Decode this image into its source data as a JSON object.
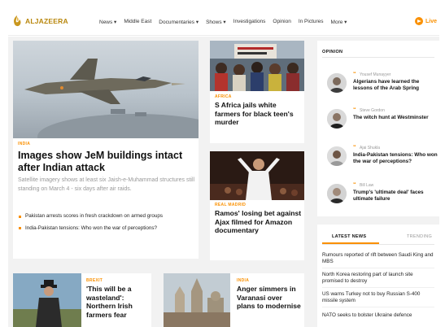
{
  "brand": {
    "name": "ALJAZEERA",
    "accent": "#fa9000",
    "logo_color": "#b8860b"
  },
  "nav": {
    "items": [
      "News ▾",
      "Middle East",
      "Documentaries ▾",
      "Shows ▾",
      "Investigations",
      "Opinion",
      "In Pictures",
      "More ▾"
    ],
    "live_label": "Live"
  },
  "hero": {
    "tag": "INDIA",
    "title": "Images show JeM buildings intact after Indian attack",
    "summary": "Satellite imagery shows at least six Jaish-e-Muhammad structures still standing on March 4 - six days after air raids.",
    "bullets": [
      "Pakistan arrests scores in fresh crackdown on armed groups",
      "India-Pakistan tensions: Who won the war of perceptions?"
    ]
  },
  "cards": {
    "mid1": {
      "tag": "AFRICA",
      "title": "S Africa jails white farmers for black teen's murder"
    },
    "mid2": {
      "tag": "REAL MADRID",
      "title": "Ramos' losing bet against Ajax filmed for Amazon documentary"
    },
    "bot1": {
      "tag": "BREXIT",
      "title": "'This will be a wasteland': Northern Irish farmers fear"
    },
    "bot2": {
      "tag": "INDIA",
      "title": "Anger simmers in Varanasi over plans to modernise"
    }
  },
  "opinion": {
    "label": "OPINION",
    "items": [
      {
        "author": "Yousef Munayyer",
        "title": "Algerians have learned the lessons of the Arab Spring"
      },
      {
        "author": "Steve Gordon",
        "title": "The witch hunt at Westminster"
      },
      {
        "author": "Ajai Shukla",
        "title": "India-Pakistan tensions: Who won the war of perceptions?"
      },
      {
        "author": "Bill Law",
        "title": "Trump's 'ultimate deal' faces ultimate failure"
      }
    ]
  },
  "latest": {
    "tab_active": "LATEST NEWS",
    "tab_inactive": "TRENDING",
    "items": [
      "Rumours reported of rift between Saudi King and MBS",
      "North Korea restoring part of launch site promised to destroy",
      "US warns Turkey not to buy Russian S-400 missile system",
      "NATO seeks to bolster Ukraine defence"
    ]
  }
}
